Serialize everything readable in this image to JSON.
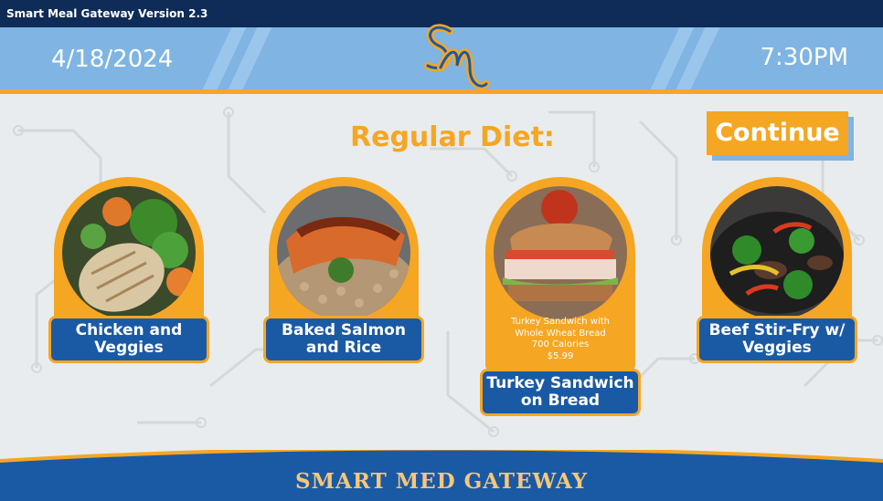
{
  "app": {
    "version_label": "Smart Meal Gateway Version 2.3",
    "date": "4/18/2024",
    "time": "7:30PM",
    "footer_title": "SMART MED GATEWAY"
  },
  "main": {
    "title": "Regular Diet:",
    "continue_label": "Continue"
  },
  "meals": [
    {
      "name": "Chicken and Veggies",
      "line1": "Chicken and",
      "line2": "Veggies"
    },
    {
      "name": "Baked Salmon and Rice",
      "line1": "Baked Salmon",
      "line2": "and Rice"
    },
    {
      "name": "Turkey Sandwich on Bread",
      "line1": "Turkey Sandwich",
      "line2": "on Bread",
      "info_line1": "Turkey Sandwich with",
      "info_line2": "Whole Wheat Bread",
      "calories": "700 Calories",
      "price": "$5.99"
    },
    {
      "name": "Beef Stir-Fry w/ Veggies",
      "line1": "Beef Stir-Fry w/",
      "line2": "Veggies"
    }
  ],
  "colors": {
    "accent_orange": "#f5a623",
    "header_blue": "#7fb4e3",
    "dark_blue": "#1a5aa5",
    "top_bar_navy": "#0f2b57"
  }
}
